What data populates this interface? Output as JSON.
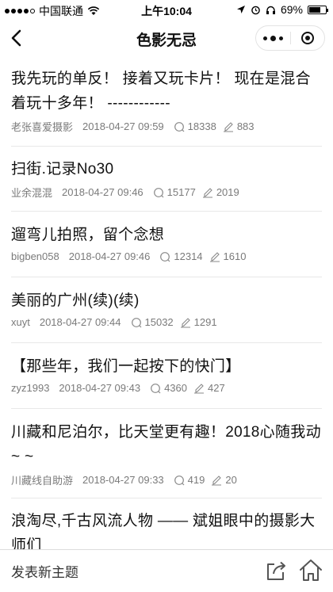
{
  "status_bar": {
    "carrier": "中国联通",
    "time": "上午10:04",
    "battery": "69%",
    "battery_level": 0.69
  },
  "nav": {
    "title": "色影无忌"
  },
  "posts": [
    {
      "title": "我先玩的单反！ 接着又玩卡片！ 现在是混合着玩十多年！ ------------",
      "author": "老张喜爱摄影",
      "time": "2018-04-27 09:59",
      "views": "18338",
      "replies": "883"
    },
    {
      "title": "扫街.记录No30",
      "author": "业余混混",
      "time": "2018-04-27 09:46",
      "views": "15177",
      "replies": "2019"
    },
    {
      "title": "遛弯儿拍照，留个念想",
      "author": "bigben058",
      "time": "2018-04-27 09:46",
      "views": "12314",
      "replies": "1610"
    },
    {
      "title": "美丽的广州(续)(续)",
      "author": "xuyt",
      "time": "2018-04-27 09:44",
      "views": "15032",
      "replies": "1291"
    },
    {
      "title": "【那些年，我们一起按下的快门】",
      "author": "zyz1993",
      "time": "2018-04-27 09:43",
      "views": "4360",
      "replies": "427"
    },
    {
      "title": "川藏和尼泊尔，比天堂更有趣！2018心随我动~ ~",
      "author": "川藏线自助游",
      "time": "2018-04-27 09:33",
      "views": "419",
      "replies": "20"
    },
    {
      "title": "浪淘尽,千古风流人物 —— 斌姐眼中的摄影大师们",
      "author": "",
      "time": "",
      "views": "",
      "replies": ""
    }
  ],
  "bottom_bar": {
    "new_topic_label": "发表新主题"
  },
  "icons": {
    "views": "comment-bubble-icon",
    "replies": "edit-pencil-icon",
    "share": "share-icon",
    "home": "home-icon"
  }
}
